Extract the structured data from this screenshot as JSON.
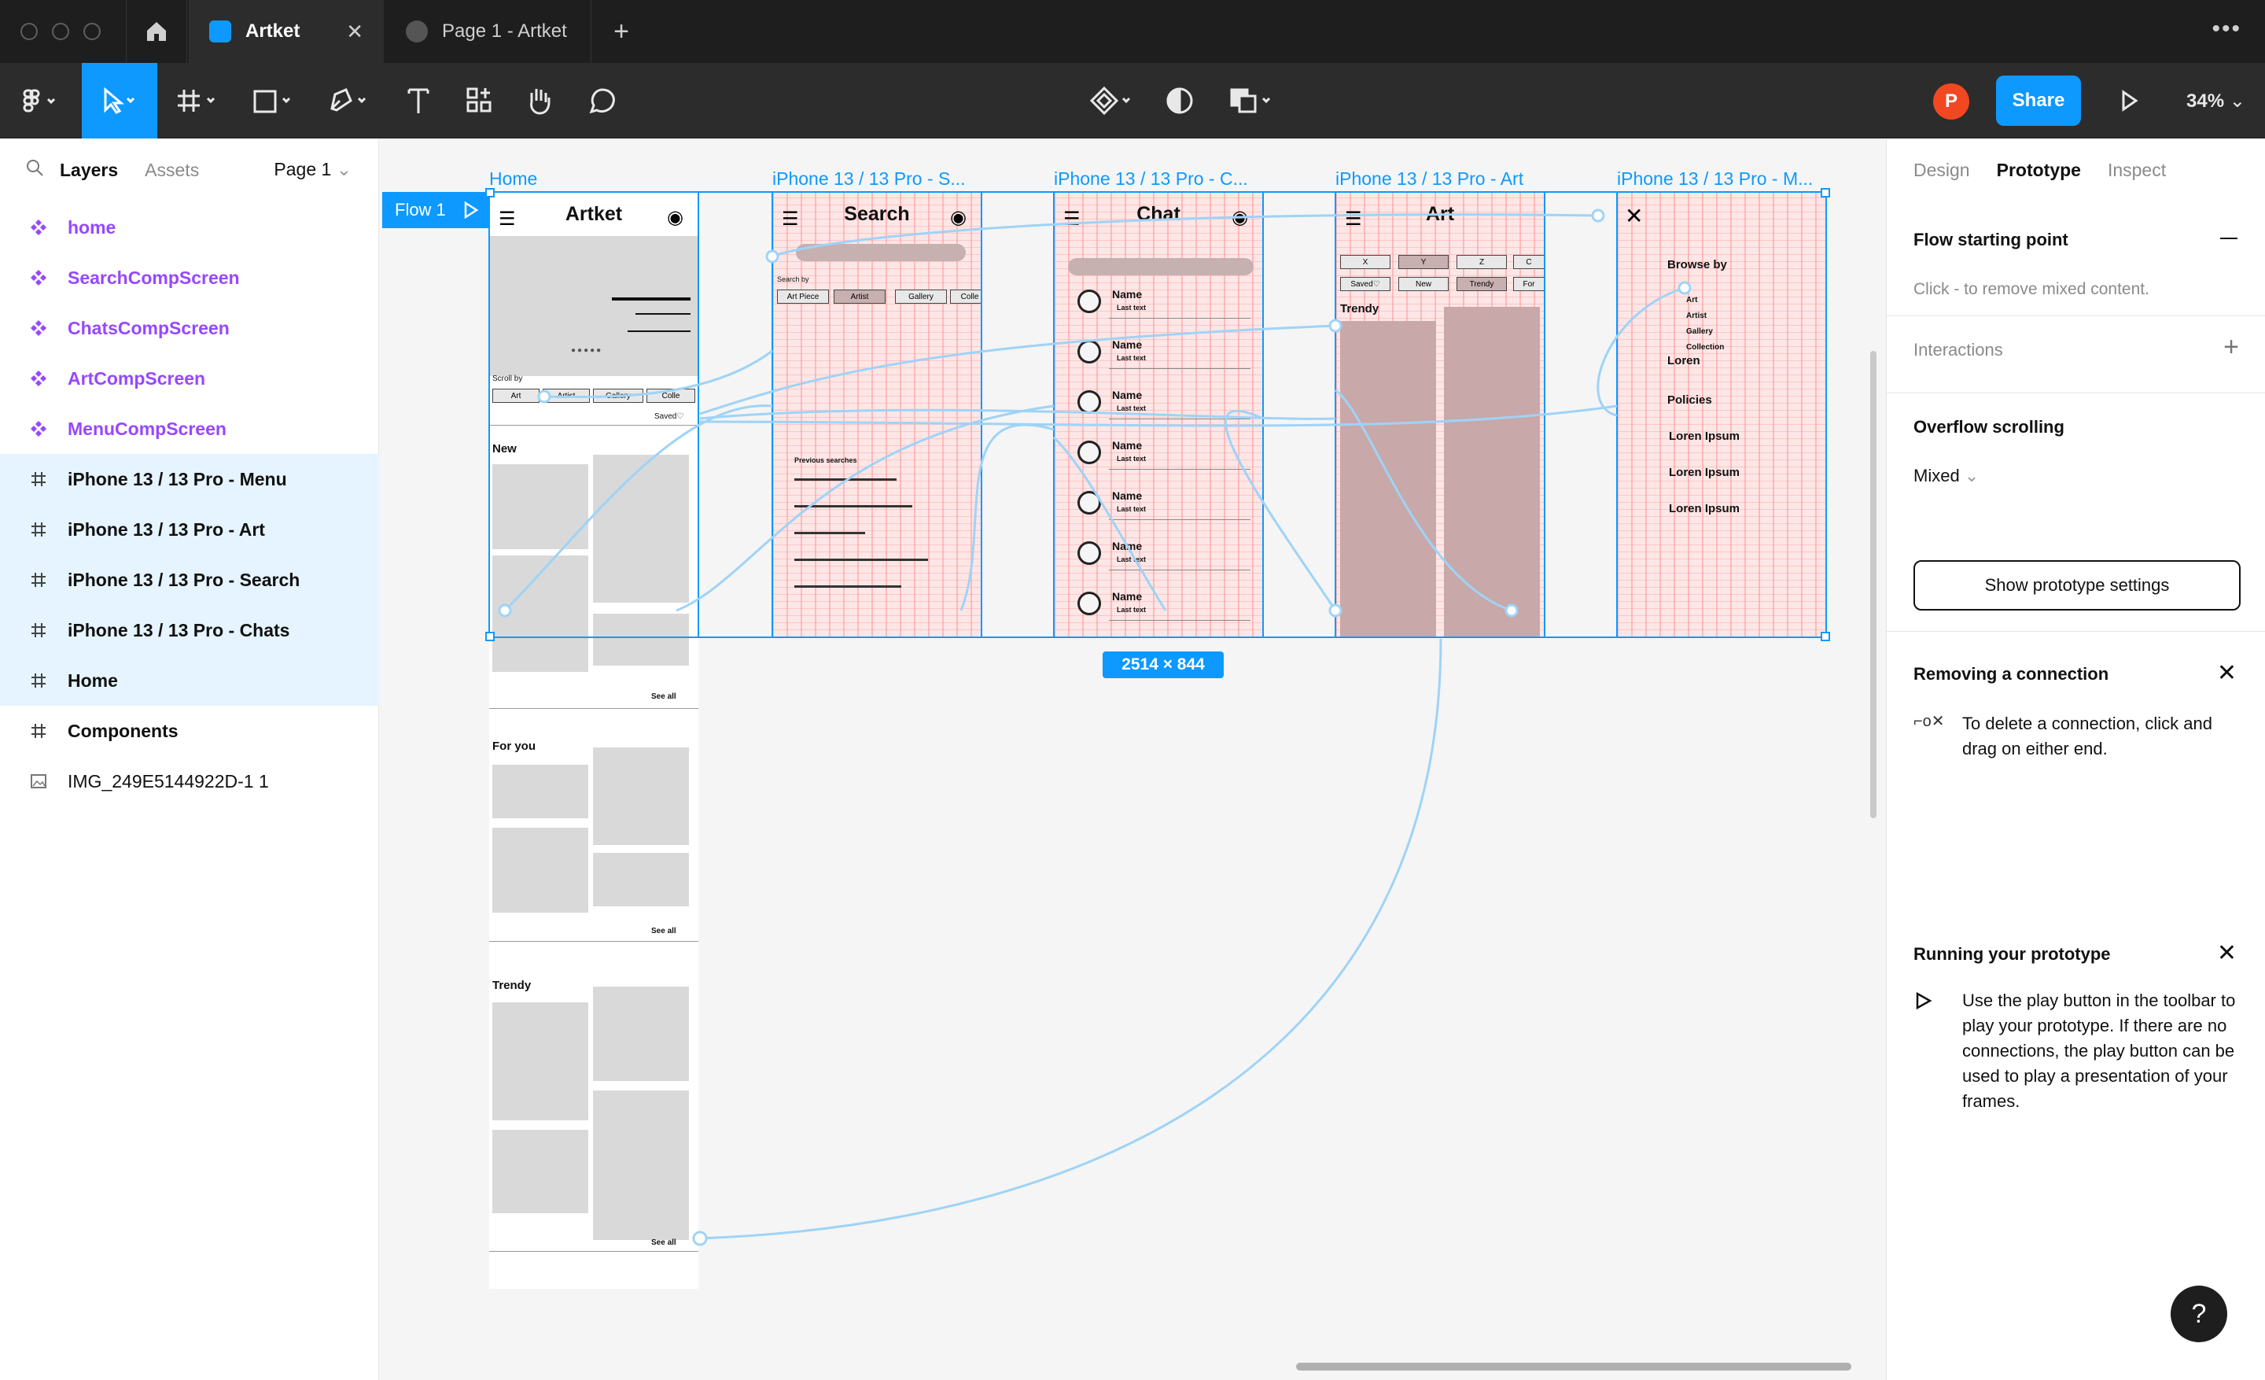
{
  "titlebar": {
    "tabs": [
      {
        "label": "Artket",
        "active": true
      },
      {
        "label": "Page 1 - Artket",
        "active": false
      }
    ]
  },
  "toolbar": {
    "avatar_initial": "P",
    "share_label": "Share",
    "zoom": "34%"
  },
  "left_panel": {
    "tabs": [
      "Layers",
      "Assets"
    ],
    "page_select": "Page 1",
    "layers": [
      {
        "label": "home",
        "kind": "component"
      },
      {
        "label": "SearchCompScreen",
        "kind": "component"
      },
      {
        "label": "ChatsCompScreen",
        "kind": "component"
      },
      {
        "label": "ArtCompScreen",
        "kind": "component"
      },
      {
        "label": "MenuCompScreen",
        "kind": "component"
      },
      {
        "label": "iPhone 13 / 13 Pro - Menu",
        "kind": "frame",
        "selected": true
      },
      {
        "label": "iPhone 13 / 13 Pro - Art",
        "kind": "frame",
        "selected": true
      },
      {
        "label": "iPhone 13 / 13 Pro - Search",
        "kind": "frame",
        "selected": true
      },
      {
        "label": "iPhone 13 / 13 Pro - Chats",
        "kind": "frame",
        "selected": true
      },
      {
        "label": "Home",
        "kind": "frame",
        "selected": true
      },
      {
        "label": "Components",
        "kind": "frame"
      },
      {
        "label": "IMG_249E5144922D-1 1",
        "kind": "image"
      }
    ]
  },
  "canvas": {
    "flow_label": "Flow 1",
    "selection_size": "2514 × 844",
    "frames": [
      {
        "label": "Home"
      },
      {
        "label": "iPhone 13 / 13 Pro - S..."
      },
      {
        "label": "iPhone 13 / 13 Pro - C..."
      },
      {
        "label": "iPhone 13 / 13 Pro - Art"
      },
      {
        "label": "iPhone 13 / 13 Pro - M..."
      }
    ],
    "home": {
      "title": "Artket",
      "scroll_by": "Scroll by",
      "chips": [
        "Art",
        "Artist",
        "Gallery",
        "Colle"
      ],
      "saved": "Saved♡",
      "sections": [
        "New",
        "For you",
        "Trendy"
      ],
      "see_all": "See all"
    },
    "search": {
      "title": "Search",
      "search_by": "Search by",
      "chips": [
        "Art Piece",
        "Artist",
        "Gallery",
        "Colle"
      ],
      "previous": "Previous searches"
    },
    "chat": {
      "title": "Chat",
      "name": "Name",
      "last_text": "Last text"
    },
    "art": {
      "title": "Art",
      "chips_row1": [
        "X",
        "Y",
        "Z",
        "C"
      ],
      "chips_row2": [
        "Saved♡",
        "New",
        "Trendy",
        "For"
      ],
      "trendy": "Trendy"
    },
    "menu": {
      "browse_by": "Browse by",
      "sub_items": [
        "Art",
        "Artist",
        "Gallery",
        "Collection"
      ],
      "loren": "Loren",
      "policies": "Policies",
      "lorem": "Loren Ipsum"
    }
  },
  "right_panel": {
    "tabs": [
      "Design",
      "Prototype",
      "Inspect"
    ],
    "flow_start_title": "Flow starting point",
    "flow_start_desc": "Click - to remove mixed content.",
    "interactions": "Interactions",
    "overflow_title": "Overflow scrolling",
    "overflow_value": "Mixed",
    "proto_settings_btn": "Show prototype settings",
    "removing_title": "Removing a connection",
    "removing_text": "To delete a connection, click and drag on either end.",
    "running_title": "Running your prototype",
    "running_text": "Use the play button in the toolbar to play your prototype. If there are no connections, the play button can be used to play a presentation of your frames."
  },
  "help_label": "?",
  "colors": {
    "accent": "#0d99ff",
    "component": "#9747ff",
    "avatar": "#f24822",
    "toolbar": "#2c2c2c"
  }
}
